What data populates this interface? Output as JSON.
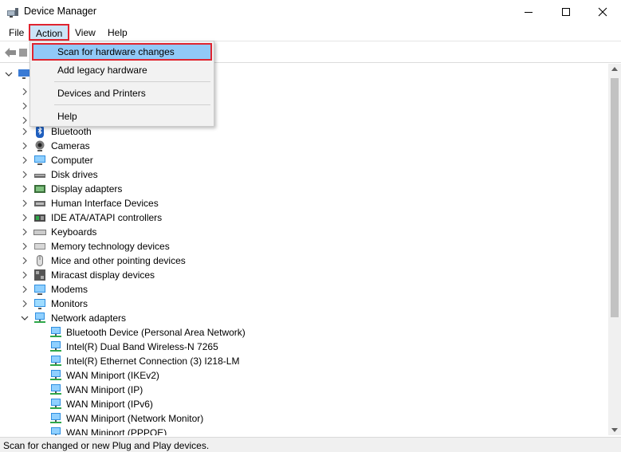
{
  "window": {
    "title": "Device Manager",
    "icons": {
      "app": "device-manager-icon",
      "minimize": "minimize-icon",
      "maximize": "maximize-icon",
      "close": "close-icon"
    }
  },
  "menu": {
    "file": "File",
    "action": "Action",
    "view": "View",
    "help": "Help"
  },
  "toolbar": {
    "icons": [
      "back-arrow-icon",
      "forward-icon"
    ]
  },
  "dropdown": {
    "items": [
      {
        "label": "Scan for hardware changes",
        "highlighted": true
      },
      {
        "label": "Add legacy hardware"
      },
      {
        "label": "Devices and Printers"
      },
      {
        "label": "Help"
      }
    ]
  },
  "tree": {
    "categories": [
      {
        "label": "Bluetooth",
        "icon": "bluetooth-icon"
      },
      {
        "label": "Cameras",
        "icon": "camera-icon"
      },
      {
        "label": "Computer",
        "icon": "computer-icon"
      },
      {
        "label": "Disk drives",
        "icon": "disk-drive-icon"
      },
      {
        "label": "Display adapters",
        "icon": "display-adapter-icon"
      },
      {
        "label": "Human Interface Devices",
        "icon": "hid-icon"
      },
      {
        "label": "IDE ATA/ATAPI controllers",
        "icon": "ide-controller-icon"
      },
      {
        "label": "Keyboards",
        "icon": "keyboard-icon"
      },
      {
        "label": "Memory technology devices",
        "icon": "memory-icon"
      },
      {
        "label": "Mice and other pointing devices",
        "icon": "mouse-icon"
      },
      {
        "label": "Miracast display devices",
        "icon": "miracast-icon"
      },
      {
        "label": "Modems",
        "icon": "modem-icon"
      },
      {
        "label": "Monitors",
        "icon": "monitor-icon"
      },
      {
        "label": "Network adapters",
        "icon": "network-adapter-icon",
        "expanded": true
      }
    ],
    "network_children": [
      "Bluetooth Device (Personal Area Network)",
      "Intel(R) Dual Band Wireless-N 7265",
      "Intel(R) Ethernet Connection (3) I218-LM",
      "WAN Miniport (IKEv2)",
      "WAN Miniport (IP)",
      "WAN Miniport (IPv6)",
      "WAN Miniport (Network Monitor)",
      "WAN Miniport (PPPOE)"
    ]
  },
  "status": {
    "text": "Scan for changed or new Plug and Play devices."
  }
}
